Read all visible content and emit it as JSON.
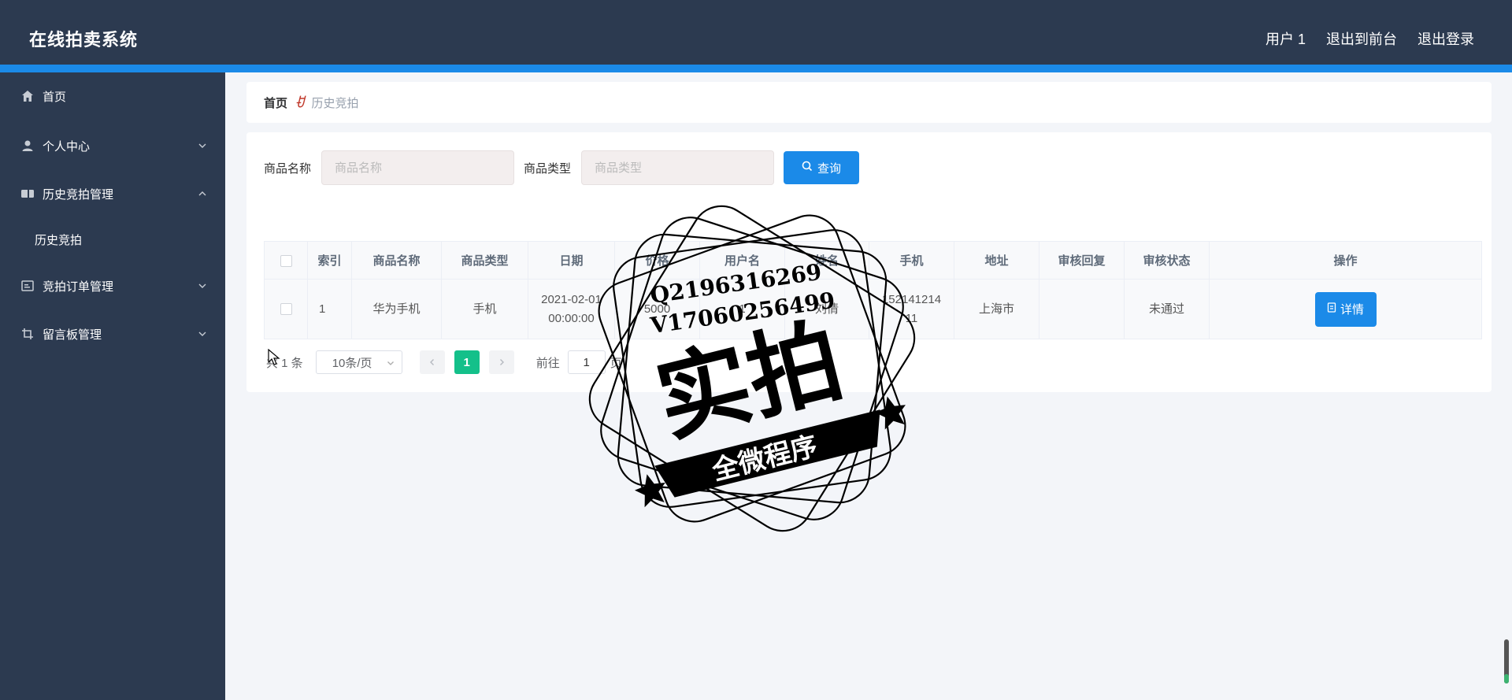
{
  "header": {
    "app_title": "在线拍卖系统",
    "user_name": "用户 1",
    "back_to_front": "退出到前台",
    "logout": "退出登录"
  },
  "sidebar": {
    "items": [
      {
        "label": "首页",
        "icon": "home-icon"
      },
      {
        "label": "个人中心",
        "icon": "user-icon"
      },
      {
        "label": "历史竞拍管理",
        "icon": "ticket-icon",
        "expanded": true
      },
      {
        "label": "竞拍订单管理",
        "icon": "order-icon"
      },
      {
        "label": "留言板管理",
        "icon": "crop-icon"
      }
    ],
    "subitems": [
      {
        "label": "历史竞拍"
      }
    ]
  },
  "breadcrumb": {
    "home": "首页",
    "current": "历史竞拍"
  },
  "search": {
    "name_label": "商品名称",
    "name_placeholder": "商品名称",
    "type_label": "商品类型",
    "type_placeholder": "商品类型",
    "query_label": "查询"
  },
  "table": {
    "headers": [
      "",
      "索引",
      "商品名称",
      "商品类型",
      "日期",
      "价格",
      "用户名",
      "姓名",
      "手机",
      "地址",
      "审核回复",
      "审核状态",
      "操作"
    ],
    "rows": [
      {
        "index": "1",
        "product_name": "华为手机",
        "product_type": "手机",
        "date_line1": "2021-02-01",
        "date_line2": "00:00:00",
        "price": "5000",
        "username": "1",
        "realname": "刘倩",
        "phone_line1": "152141214",
        "phone_line2": "11",
        "address": "上海市",
        "review_reply": "",
        "review_status": "未通过",
        "action_label": "详情"
      }
    ]
  },
  "pagination": {
    "total": "共 1 条",
    "page_size": "10条/页",
    "current_page": "1",
    "goto_label": "前往",
    "goto_value": "1",
    "goto_suffix": "页"
  },
  "watermark": {
    "line1": "Q2196316269",
    "line2": "V17060256499",
    "main": "实拍",
    "banner": "全微程序"
  },
  "colors": {
    "header_bg": "#2c3a50",
    "accent_blue": "#1b8ae8",
    "page_active_green": "#14c08a"
  }
}
